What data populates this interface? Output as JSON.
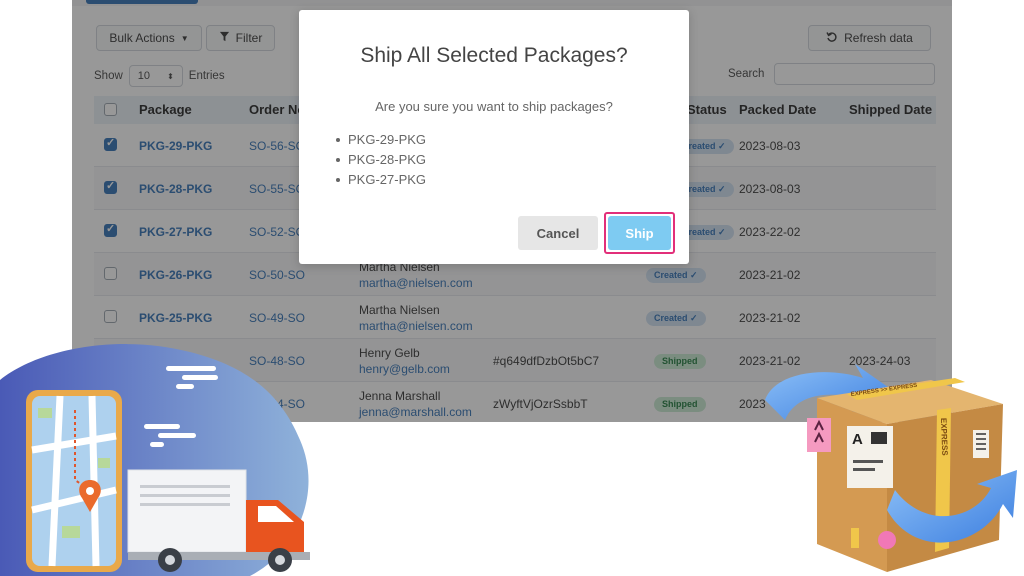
{
  "toolbar": {
    "bulk_actions_label": "Bulk Actions",
    "filter_label": "Filter",
    "refresh_label": "Refresh data"
  },
  "table_controls": {
    "show_label": "Show",
    "entries_value": "10",
    "entries_label": "Entries",
    "search_label": "Search",
    "search_value": ""
  },
  "table": {
    "columns": [
      "Package",
      "Order No",
      "",
      "",
      "Status",
      "Packed Date",
      "Shipped Date"
    ],
    "rows": [
      {
        "checked": true,
        "package": "PKG-29-PKG",
        "order": "SO-56-SO",
        "customer": "",
        "email": "",
        "tracking": "",
        "status": "Created",
        "packed": "2023-08-03",
        "shipped": ""
      },
      {
        "checked": true,
        "package": "PKG-28-PKG",
        "order": "SO-55-SO",
        "customer": "",
        "email": "",
        "tracking": "",
        "status": "Created",
        "packed": "2023-08-03",
        "shipped": ""
      },
      {
        "checked": true,
        "package": "PKG-27-PKG",
        "order": "SO-52-SO",
        "customer": "",
        "email": "",
        "tracking": "",
        "status": "Created",
        "packed": "2023-22-02",
        "shipped": ""
      },
      {
        "checked": false,
        "package": "PKG-26-PKG",
        "order": "SO-50-SO",
        "customer": "Martha Nielsen",
        "email": "martha@nielsen.com",
        "tracking": "",
        "status": "Created",
        "packed": "2023-21-02",
        "shipped": ""
      },
      {
        "checked": false,
        "package": "PKG-25-PKG",
        "order": "SO-49-SO",
        "customer": "Martha Nielsen",
        "email": "martha@nielsen.com",
        "tracking": "",
        "status": "Created",
        "packed": "2023-21-02",
        "shipped": ""
      },
      {
        "checked": false,
        "package": "",
        "order": "SO-48-SO",
        "customer": "Henry Gelb",
        "email": "henry@gelb.com",
        "tracking": "#q649dfDzbOt5bC7",
        "status": "Shipped",
        "packed": "2023-21-02",
        "shipped": "2023-24-03"
      },
      {
        "checked": false,
        "package": "",
        "order": "SO-44-SO",
        "customer": "Jenna Marshall",
        "email": "jenna@marshall.com",
        "tracking": "zWyftVjOzrSsbbT",
        "status": "Shipped",
        "packed": "2023",
        "shipped": ""
      }
    ]
  },
  "modal": {
    "title": "Ship All Selected Packages?",
    "message": "Are you sure you want to ship packages?",
    "packages": [
      "PKG-29-PKG",
      "PKG-28-PKG",
      "PKG-27-PKG"
    ],
    "cancel_label": "Cancel",
    "ship_label": "Ship"
  },
  "box_labels": {
    "express_tape": "EXPRESS >> EXPRESS",
    "express_side": "EXPRESS",
    "letter_a": "A"
  },
  "colors": {
    "accent": "#2f6fb4",
    "ship_button": "#7ecbf2",
    "highlight_ring": "#e22f7a",
    "created_badge": "#cfe0f2",
    "shipped_badge": "#c8ead2"
  }
}
